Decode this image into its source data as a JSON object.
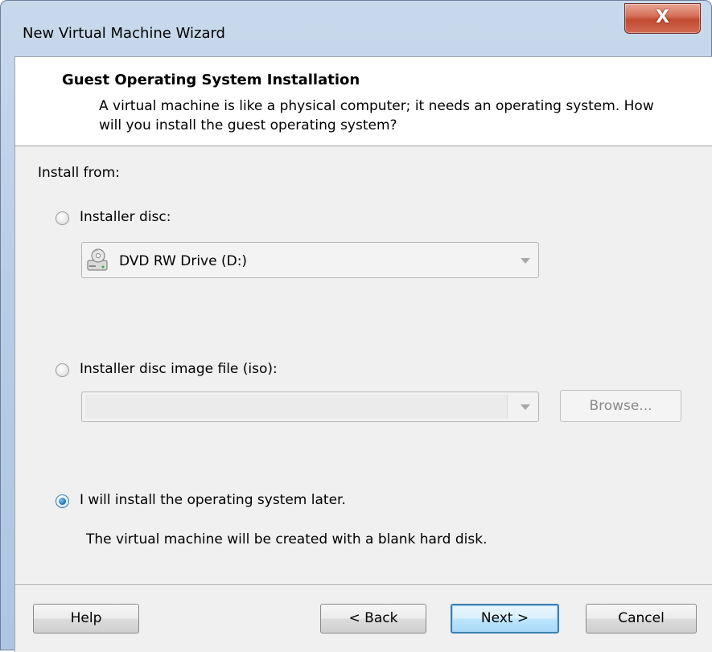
{
  "window": {
    "title": "New Virtual Machine Wizard",
    "close_label": "X"
  },
  "header": {
    "title": "Guest Operating System Installation",
    "description": "A virtual machine is like a physical computer; it needs an operating system. How will you install the guest operating system?"
  },
  "install_from_label": "Install from:",
  "options": {
    "installer_disc": {
      "label": "Installer disc:",
      "checked": false,
      "drive_value": "DVD RW Drive (D:)",
      "drive_icon": "optical-drive-icon"
    },
    "iso_image": {
      "label": "Installer disc image file (iso):",
      "checked": false,
      "value": "",
      "browse_label": "Browse..."
    },
    "install_later": {
      "label": "I will install the operating system later.",
      "checked": true,
      "note": "The virtual machine will be created with a blank hard disk."
    }
  },
  "buttons": {
    "help": "Help",
    "back": "< Back",
    "next": "Next >",
    "cancel": "Cancel"
  },
  "colors": {
    "accent": "#3c7fb1",
    "close_button": "#c14a31",
    "frame": "#b8cde6"
  }
}
